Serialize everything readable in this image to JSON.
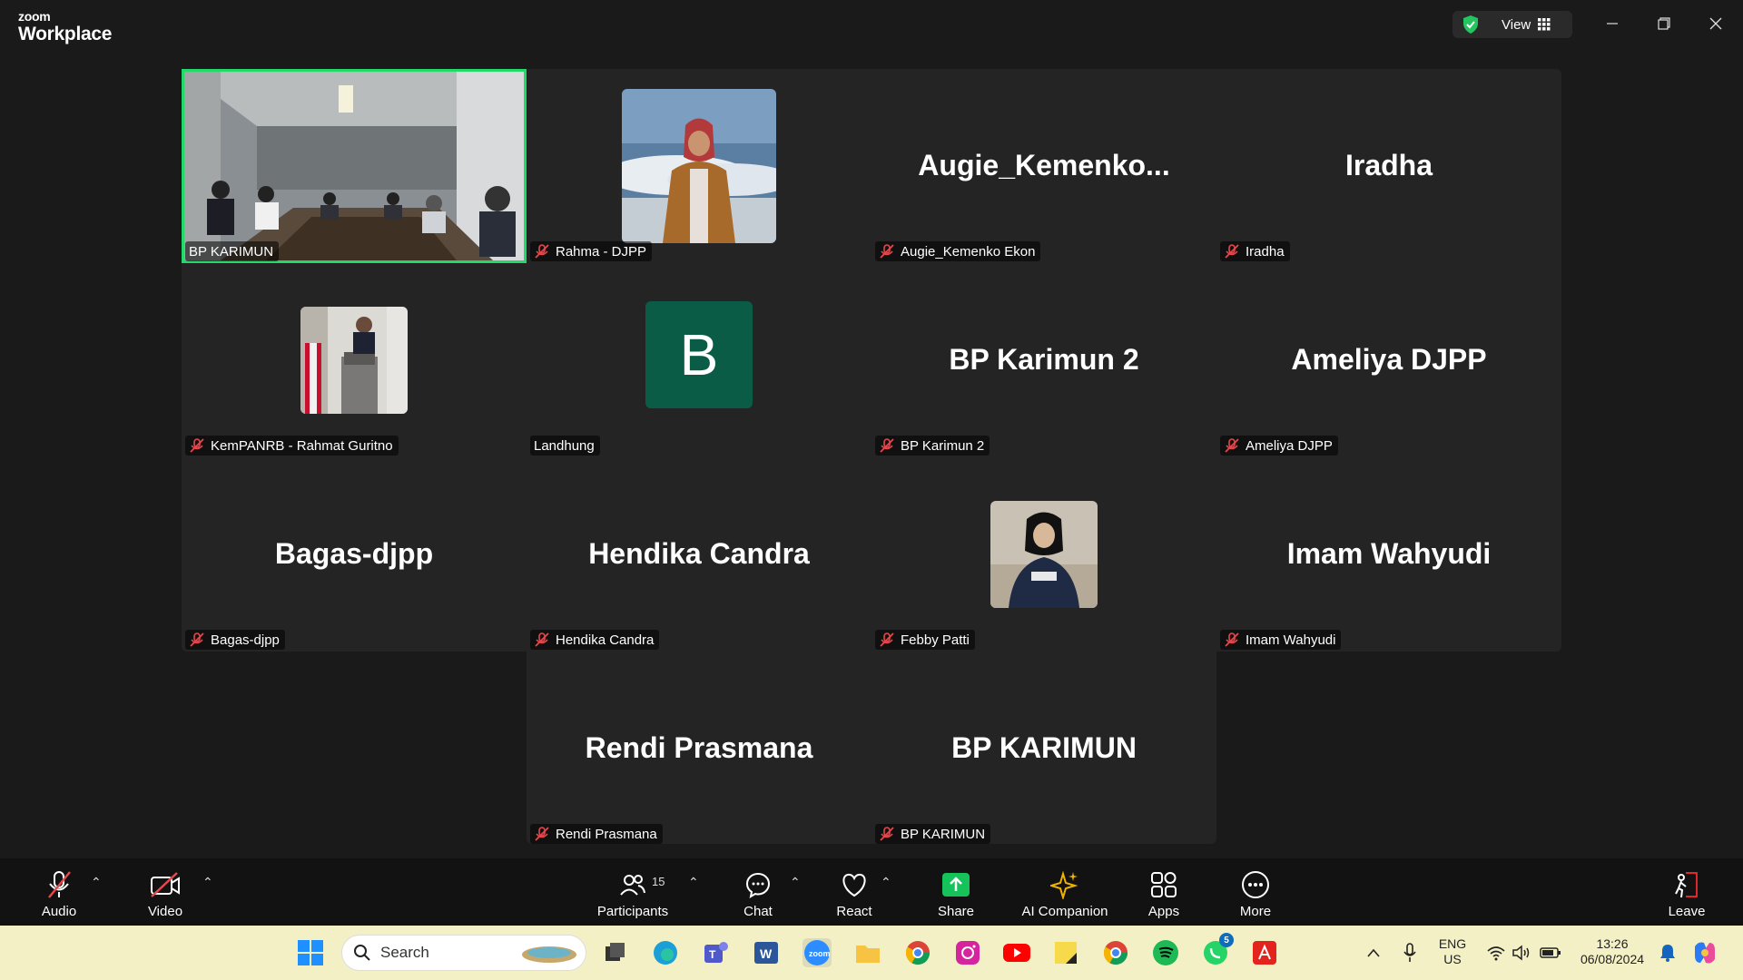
{
  "app": {
    "brand_top": "zoom",
    "brand_bottom": "Workplace"
  },
  "titlebar": {
    "view_label": "View"
  },
  "tiles": [
    {
      "label": "BP KARIMUN",
      "bigname": "",
      "muted": false
    },
    {
      "label": "Rahma - DJPP",
      "bigname": "",
      "muted": true
    },
    {
      "label": "Augie_Kemenko Ekon",
      "bigname": "Augie_Kemenko...",
      "muted": true
    },
    {
      "label": "Iradha",
      "bigname": "Iradha",
      "muted": true
    },
    {
      "label": "KemPANRB - Rahmat Guritno",
      "bigname": "",
      "muted": true
    },
    {
      "label": "Landhung",
      "bigname": "",
      "avatar_letter": "B",
      "muted": false
    },
    {
      "label": "BP Karimun 2",
      "bigname": "BP Karimun 2",
      "muted": true
    },
    {
      "label": "Ameliya DJPP",
      "bigname": "Ameliya DJPP",
      "muted": true
    },
    {
      "label": "Bagas-djpp",
      "bigname": "Bagas-djpp",
      "muted": true
    },
    {
      "label": "Hendika Candra",
      "bigname": "Hendika Candra",
      "muted": true
    },
    {
      "label": "Febby Patti",
      "bigname": "",
      "muted": true
    },
    {
      "label": "Imam Wahyudi",
      "bigname": "Imam Wahyudi",
      "muted": true
    },
    {
      "label": "Rendi Prasmana",
      "bigname": "Rendi Prasmana",
      "muted": true
    },
    {
      "label": "BP KARIMUN",
      "bigname": "BP KARIMUN",
      "muted": true
    }
  ],
  "toolbar": {
    "audio": "Audio",
    "video": "Video",
    "participants": "Participants",
    "participants_count": "15",
    "chat": "Chat",
    "react": "React",
    "share": "Share",
    "ai_companion": "AI Companion",
    "apps": "Apps",
    "more": "More",
    "leave": "Leave"
  },
  "taskbar": {
    "search_placeholder": "Search",
    "lang_top": "ENG",
    "lang_bottom": "US",
    "time": "13:26",
    "date": "06/08/2024",
    "whatsapp_badge": "5"
  },
  "colors": {
    "active_speaker": "#23d96a",
    "muted_icon": "#e5484d",
    "share_green": "#16c25a",
    "leave_red": "#e02828"
  }
}
